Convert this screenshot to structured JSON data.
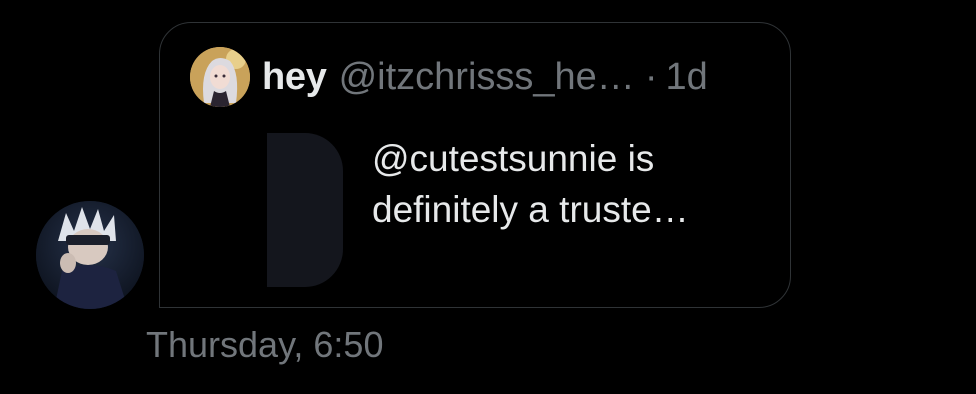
{
  "quoted_tweet": {
    "author_name": "hey",
    "author_handle": "@itzchrisss_he…",
    "separator": "·",
    "time": "1d",
    "text": "@cutestsunnie is definitely a truste…"
  },
  "message": {
    "timestamp": "Thursday, 6:50"
  },
  "colors": {
    "background": "#000000",
    "primary_text": "#e7e9ea",
    "secondary_text": "#71767b",
    "card_border": "#2f3336"
  },
  "icons": {
    "sender_avatar": "sender-avatar-image",
    "author_avatar": "author-avatar-image"
  }
}
